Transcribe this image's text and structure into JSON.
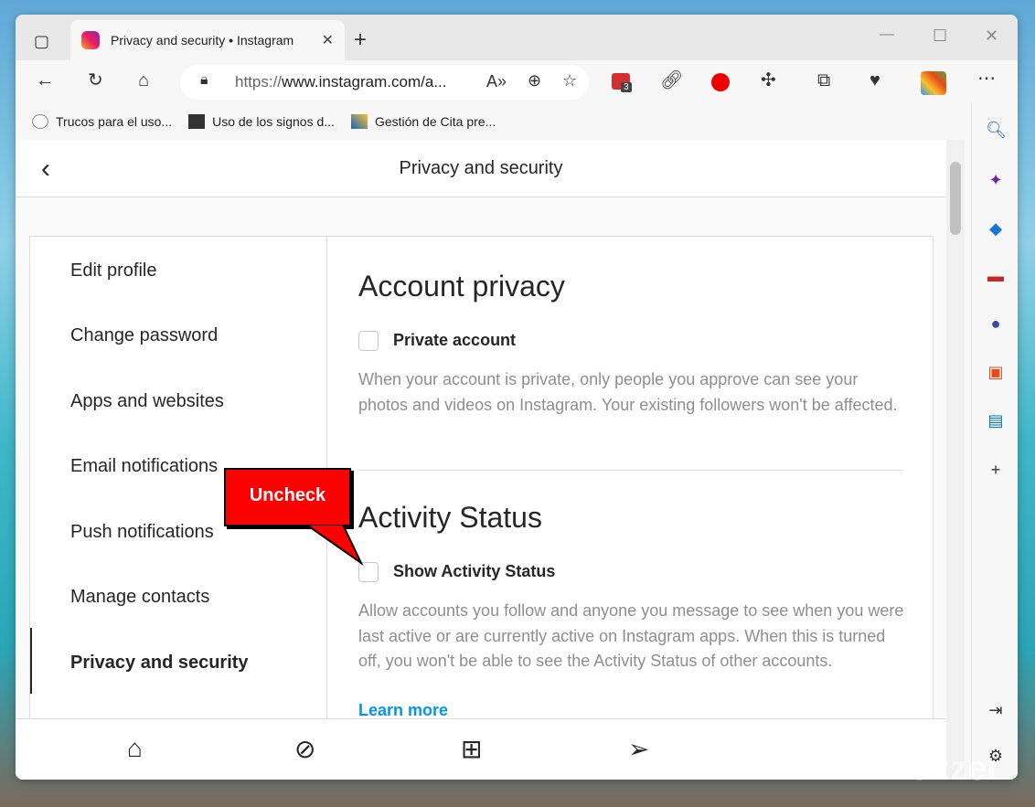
{
  "browser": {
    "tab_title": "Privacy and security • Instagram",
    "url_prefix": "https://",
    "url_rest": "www.instagram.com/a...",
    "bookmarks": [
      "Trucos para el uso...",
      "Uso de los signos d...",
      "Gestión de Cita pre..."
    ],
    "extension_badge": "3"
  },
  "page": {
    "title": "Privacy and security",
    "nav": [
      "Edit profile",
      "Change password",
      "Apps and websites",
      "Email notifications",
      "Push notifications",
      "Manage contacts",
      "Privacy and security"
    ],
    "account_privacy": {
      "heading": "Account privacy",
      "checkbox": "Private account",
      "desc": "When your account is private, only people you approve can see your photos and videos on Instagram. Your existing followers won't be affected."
    },
    "activity": {
      "heading": "Activity Status",
      "checkbox": "Show Activity Status",
      "desc": "Allow accounts you follow and anyone you message to see when you were last active or are currently active on Instagram apps. When this is turned off, you won't be able to see the Activity Status of other accounts.",
      "link": "Learn more"
    }
  },
  "annotation": "Uncheck",
  "watermark": "WinBuzzer",
  "colors": {
    "accent": "#0095f6",
    "callout": "#ff0000"
  }
}
